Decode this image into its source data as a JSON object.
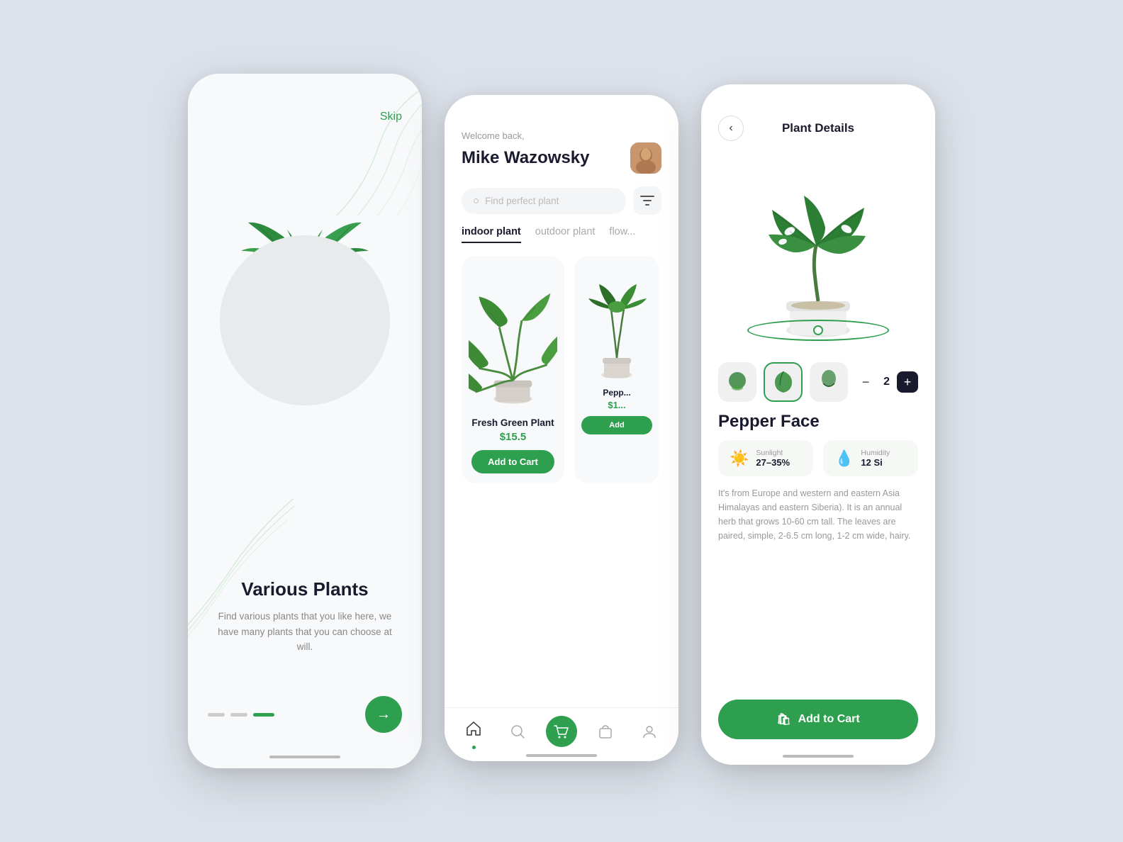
{
  "phone1": {
    "skip_label": "Skip",
    "title": "Various Plants",
    "subtitle": "Find various plants that you like here, we have many plants that you can choose at will.",
    "dots": [
      "inactive",
      "inactive",
      "active"
    ],
    "next_arrow": "→"
  },
  "phone2": {
    "welcome": "Welcome back,",
    "user_name": "Mike Wazowsky",
    "search_placeholder": "Find perfect plant",
    "filter_icon": "⚙",
    "tabs": [
      {
        "label": "indoor plant",
        "active": true
      },
      {
        "label": "outdoor plant",
        "active": false
      },
      {
        "label": "flow...",
        "active": false
      }
    ],
    "plants": [
      {
        "name": "Fresh Green Plant",
        "price": "$15.5",
        "add_label": "Add to Cart"
      },
      {
        "name": "Pepp...",
        "price": "$1...",
        "add_label": "Add"
      }
    ],
    "nav_items": [
      {
        "icon": "🏠",
        "active": true,
        "has_dot": true
      },
      {
        "icon": "🔍",
        "active": false
      },
      {
        "icon": "🛒",
        "active": true,
        "is_main": true
      },
      {
        "icon": "🛍",
        "active": false
      },
      {
        "icon": "👤",
        "active": false
      }
    ]
  },
  "phone3": {
    "header_title": "Plant Details",
    "back_label": "‹",
    "plant_name": "Pepper Face",
    "quantity": "2",
    "minus_label": "−",
    "plus_label": "+",
    "sunlight_label": "Sunlight",
    "sunlight_value": "27–35%",
    "humidity_label": "Humidity",
    "humidity_value": "12 Si",
    "description": "It's from Europe and western and eastern Asia Himalayas and eastern Siberia). It is an annual herb that grows 10-60 cm tall. The leaves are paired, simple, 2-6.5 cm long, 1-2 cm wide, hairy.",
    "add_cart_label": "Add to Cart",
    "cart_icon": "🛍"
  }
}
